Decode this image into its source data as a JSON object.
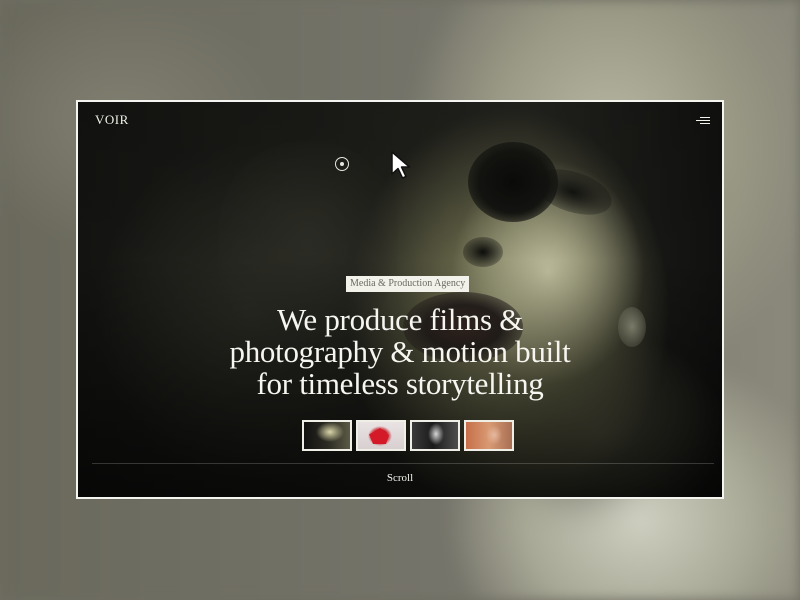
{
  "site": {
    "logo": "VOIR",
    "menu_icon": "hamburger-menu-icon",
    "target_icon": "target-circle-icon",
    "cursor_icon": "arrow-cursor-icon"
  },
  "hero": {
    "tag": "Media & Production Agency",
    "headline_lines": [
      "We produce films &",
      "photography & motion built",
      "for timeless storytelling"
    ],
    "thumbnails": [
      {
        "name": "thumbnail-portrait-dark"
      },
      {
        "name": "thumbnail-red-sculpture"
      },
      {
        "name": "thumbnail-bw-woman"
      },
      {
        "name": "thumbnail-warm-scene"
      }
    ],
    "scroll_label": "Scroll"
  },
  "colors": {
    "frame_border": "#f4f4f0",
    "text_light": "#f6f5ef",
    "tag_background": "#f2f1ea",
    "tag_text": "#6b6a62"
  }
}
